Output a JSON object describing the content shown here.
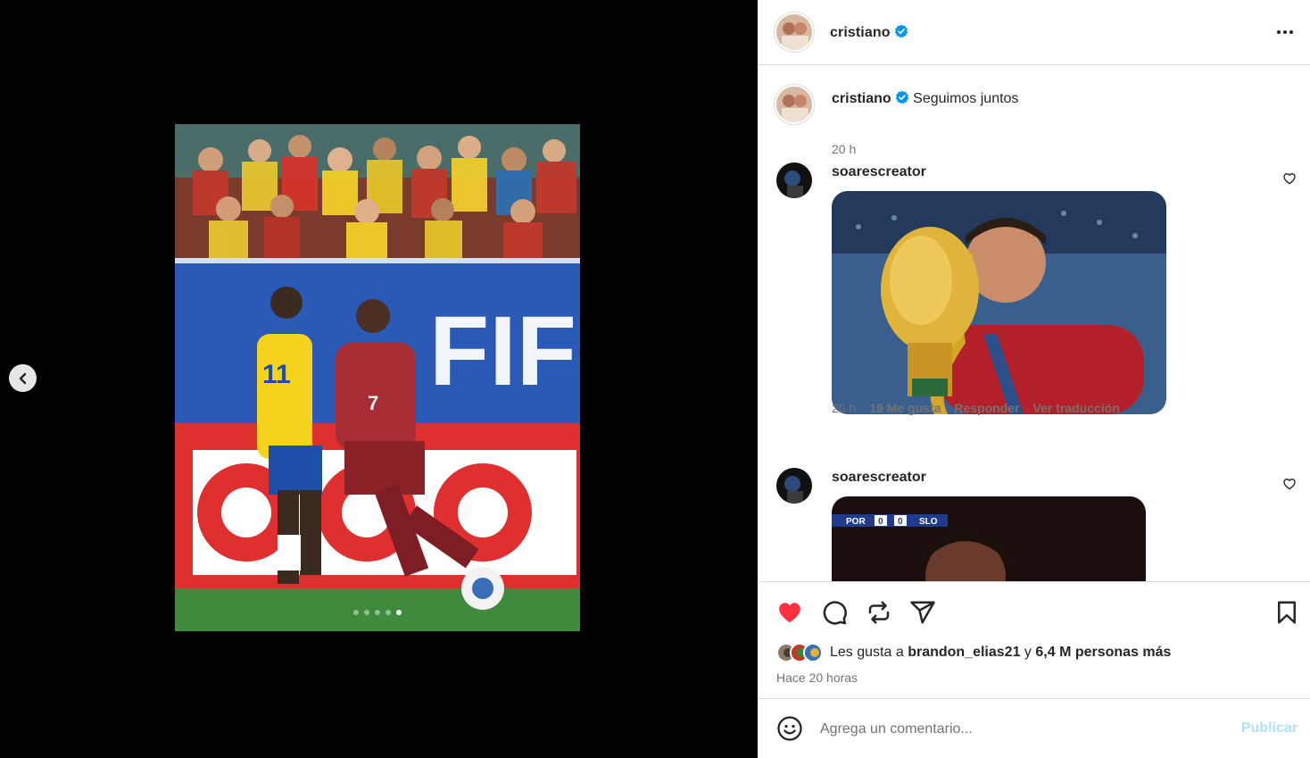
{
  "post": {
    "author": "cristiano",
    "verified": true,
    "caption_text": "Seguimos juntos",
    "caption_time": "20 h",
    "carousel": {
      "dots": 5,
      "active_index": 4
    }
  },
  "comments": [
    {
      "user": "soarescreator",
      "time": "20 h",
      "likes": "19 Me gusta",
      "reply": "Responder",
      "translate": "Ver traducción"
    },
    {
      "user": "soarescreator",
      "scoreboard": {
        "home": "POR",
        "home_score": "0",
        "away_score": "0",
        "away": "SLO"
      }
    }
  ],
  "likes": {
    "prefix": "Les gusta a",
    "user": "brandon_elias21",
    "connector": "y",
    "others": "6,4 M personas más",
    "liked": true
  },
  "timestamp": "Hace 20 horas",
  "composer": {
    "placeholder": "Agrega un comentario...",
    "post_label": "Publicar"
  },
  "icons": {
    "more": "more-horizontal-icon",
    "prev": "chevron-left-icon",
    "like": "heart-icon",
    "comment": "comment-icon",
    "repost": "repost-icon",
    "share": "send-icon",
    "save": "bookmark-icon",
    "emoji": "emoji-icon",
    "verified": "verified-badge-icon"
  },
  "colors": {
    "like_red": "#ff3040",
    "verified_blue": "#0095f6",
    "publish_disabled": "#b2dffc",
    "secondary_text": "#737373"
  }
}
